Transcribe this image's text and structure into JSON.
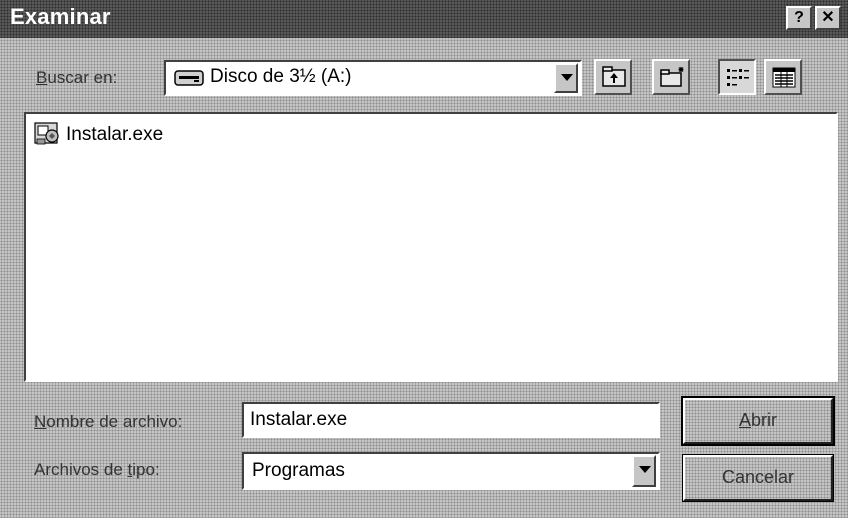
{
  "window": {
    "title": "Examinar",
    "help_label": "?",
    "close_label": "✕"
  },
  "look_in": {
    "label_accel": "B",
    "label_rest": "uscar en:",
    "value": "Disco de 3½ (A:)",
    "icon": "floppy-drive-icon"
  },
  "toolbar": {
    "buttons": [
      {
        "name": "up-one-level",
        "icon": "folder-up-icon"
      },
      {
        "name": "create-new-folder",
        "icon": "new-folder-icon"
      },
      {
        "name": "list-view",
        "icon": "list-view-icon",
        "pressed": true
      },
      {
        "name": "details-view",
        "icon": "details-view-icon"
      }
    ]
  },
  "files": [
    {
      "name": "Instalar.exe",
      "icon": "installer-exe-icon"
    }
  ],
  "filename": {
    "label_accel": "N",
    "label_rest": "ombre de archivo:",
    "value": "Instalar.exe"
  },
  "filetype": {
    "label_pre": "Archivos de ",
    "label_accel": "t",
    "label_rest": "ipo:",
    "value": "Programas"
  },
  "buttons": {
    "open_accel": "A",
    "open_rest": "brir",
    "cancel": "Cancelar"
  }
}
